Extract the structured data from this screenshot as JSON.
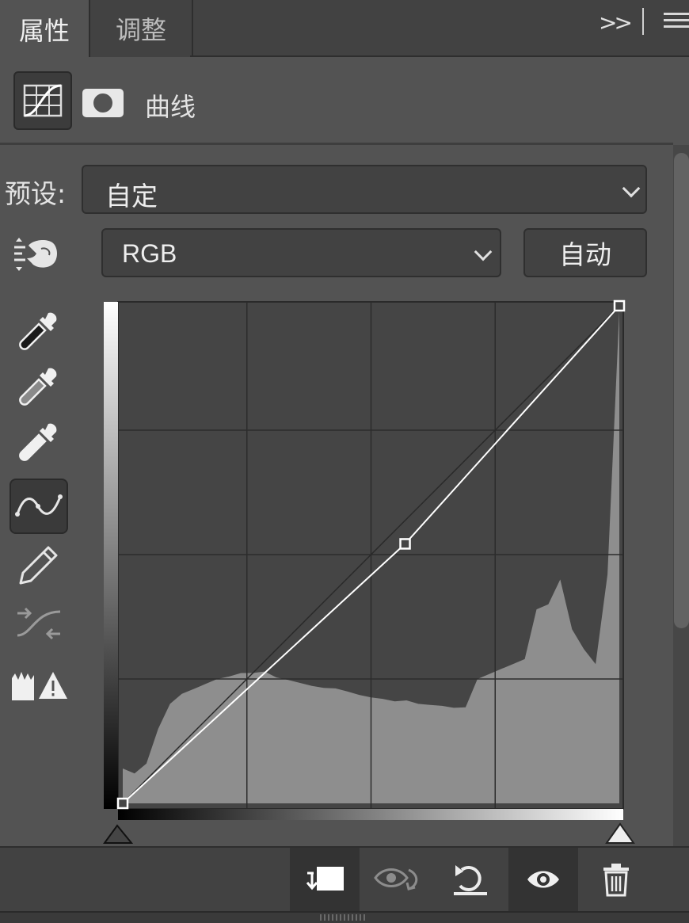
{
  "tabs": {
    "properties": "属性",
    "adjustments": "调整"
  },
  "panel": {
    "title": "曲线",
    "collapse_glyph": ">>"
  },
  "preset": {
    "label": "预设:",
    "value": "自定"
  },
  "channel": {
    "value": "RGB",
    "auto_label": "自动"
  },
  "tools": [
    "target-adjust",
    "black-point-eyedropper",
    "gray-point-eyedropper",
    "white-point-eyedropper",
    "edit-points-curve",
    "draw-pencil",
    "smooth-curve",
    "clipping-warning"
  ],
  "active_tool": "edit-points-curve",
  "curve": {
    "points": [
      [
        0,
        0
      ],
      [
        145,
        133
      ],
      [
        255,
        255
      ]
    ],
    "grid_divisions": 4
  },
  "histogram": {
    "levels": [
      0.07,
      0.06,
      0.08,
      0.15,
      0.2,
      0.22,
      0.23,
      0.24,
      0.25,
      0.255,
      0.262,
      0.262,
      0.265,
      0.253,
      0.248,
      0.242,
      0.236,
      0.232,
      0.231,
      0.225,
      0.218,
      0.213,
      0.21,
      0.205,
      0.207,
      0.2,
      0.198,
      0.196,
      0.192,
      0.193,
      0.25,
      0.26,
      0.27,
      0.28,
      0.29,
      0.39,
      0.4,
      0.45,
      0.35,
      0.31,
      0.28,
      0.46,
      0.99
    ]
  },
  "bottom_bar": [
    "clip-to-layer",
    "view-previous-state",
    "reset-adjustment",
    "toggle-visibility",
    "delete-layer"
  ],
  "colors": {
    "panel_bg": "#535353",
    "graph_bg": "#454545",
    "histogram": "#8e8e8e",
    "curve": "#ffffff"
  }
}
